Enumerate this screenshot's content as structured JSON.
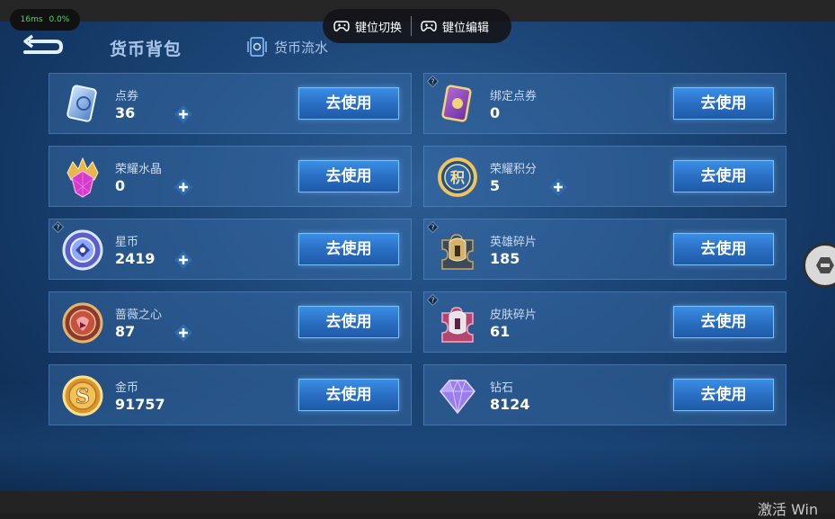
{
  "status": {
    "latency": "16ms",
    "loss": "0.0%"
  },
  "keybar": {
    "switch_label": "键位切换",
    "edit_label": "键位编辑"
  },
  "header": {
    "title": "货币背包",
    "flow_label": "货币流水"
  },
  "use_label": "去使用",
  "cards": [
    {
      "name": "点券",
      "value": "36",
      "icon": "voucher-icon",
      "plus": true,
      "help": false
    },
    {
      "name": "绑定点券",
      "value": "0",
      "icon": "bound-voucher-icon",
      "plus": false,
      "help": true
    },
    {
      "name": "荣耀水晶",
      "value": "0",
      "icon": "glory-crystal-icon",
      "plus": true,
      "help": false
    },
    {
      "name": "荣耀积分",
      "value": "5",
      "icon": "glory-points-icon",
      "plus": true,
      "help": false
    },
    {
      "name": "星币",
      "value": "2419",
      "icon": "star-coin-icon",
      "plus": true,
      "help": true
    },
    {
      "name": "英雄碎片",
      "value": "185",
      "icon": "hero-fragment-icon",
      "plus": false,
      "help": true
    },
    {
      "name": "蔷薇之心",
      "value": "87",
      "icon": "rose-heart-icon",
      "plus": true,
      "help": false
    },
    {
      "name": "皮肤碎片",
      "value": "61",
      "icon": "skin-fragment-icon",
      "plus": false,
      "help": true
    },
    {
      "name": "金币",
      "value": "91757",
      "icon": "gold-coin-icon",
      "plus": false,
      "help": false
    },
    {
      "name": "钻石",
      "value": "8124",
      "icon": "diamond-icon",
      "plus": false,
      "help": false
    }
  ],
  "watermark": "激活 Win"
}
